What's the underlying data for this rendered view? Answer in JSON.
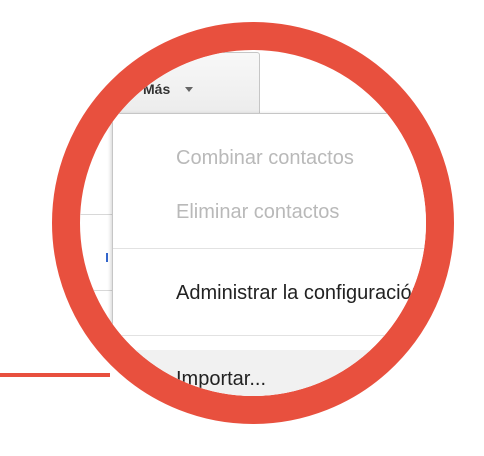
{
  "toolbar": {
    "more_label": "Más"
  },
  "more_menu": {
    "items": [
      {
        "label": "Combinar contactos",
        "enabled": false
      },
      {
        "label": "Eliminar contactos",
        "enabled": false
      },
      {
        "label": "Administrar la configuración",
        "enabled": true
      },
      {
        "label": "Importar...",
        "enabled": true
      }
    ]
  },
  "colors": {
    "callout_accent": "#e8503e",
    "disabled_text": "#b9b9b9",
    "enabled_text": "#222222"
  },
  "icons": {
    "more_caret": "chevron-down-icon"
  }
}
